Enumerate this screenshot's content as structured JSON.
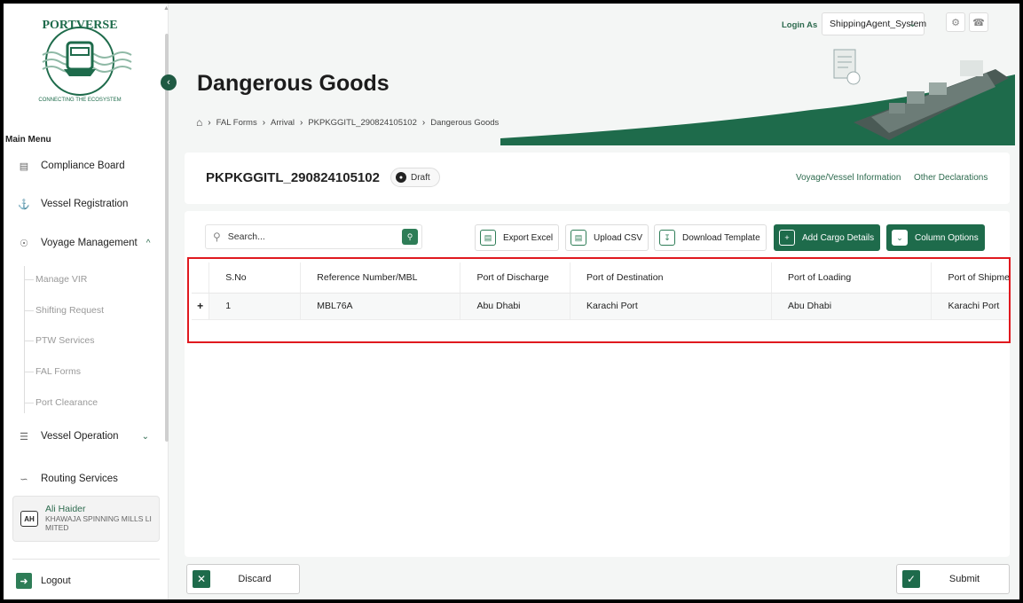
{
  "sidebar": {
    "main_menu_label": "Main Menu",
    "logo_text": "PORTVERSE",
    "logo_tagline": "CONNECTING THE ECOSYSTEM",
    "items": [
      {
        "label": "Compliance Board",
        "icon": "clipboard-icon"
      },
      {
        "label": "Vessel Registration",
        "icon": "ship-icon"
      },
      {
        "label": "Voyage Management",
        "icon": "compass-icon",
        "expanded": true
      },
      {
        "label": "Vessel Operation",
        "icon": "crane-icon"
      },
      {
        "label": "Routing Services",
        "icon": "route-icon"
      }
    ],
    "voyage_sub_items": [
      "Manage VIR",
      "Shifting Request",
      "PTW Services",
      "FAL Forms",
      "Port Clearance"
    ],
    "user": {
      "initials": "AH",
      "name": "Ali Haider",
      "org": "KHAWAJA SPINNING MILLS LIMITED"
    },
    "logout_label": "Logout"
  },
  "topbar": {
    "login_as_label": "Login As",
    "role_value": "ShippingAgent_System"
  },
  "header": {
    "title": "Dangerous Goods",
    "breadcrumb": [
      "FAL Forms",
      "Arrival",
      "PKPKGGITL_290824105102",
      "Dangerous Goods"
    ]
  },
  "info": {
    "reference": "PKPKGGITL_290824105102",
    "status": "Draft",
    "link_voyage": "Voyage/Vessel Information",
    "link_other": "Other Declarations"
  },
  "toolbar": {
    "search_placeholder": "Search...",
    "export_excel": "Export Excel",
    "upload_csv": "Upload CSV",
    "download_template": "Download Template",
    "add_cargo": "Add Cargo Details",
    "column_options": "Column Options"
  },
  "table": {
    "columns": [
      "S.No",
      "Reference Number/MBL",
      "Port of Discharge",
      "Port of Destination",
      "Port of Loading",
      "Port of Shipme"
    ],
    "rows": [
      {
        "expand": "+",
        "cells": [
          "1",
          "MBL76A",
          "Abu Dhabi",
          "Karachi Port",
          "Abu Dhabi",
          "Karachi Port"
        ]
      }
    ]
  },
  "footer": {
    "discard": "Discard",
    "submit": "Submit"
  },
  "colors": {
    "brand_green": "#1e6b4b",
    "highlight_red": "#e0191f"
  }
}
